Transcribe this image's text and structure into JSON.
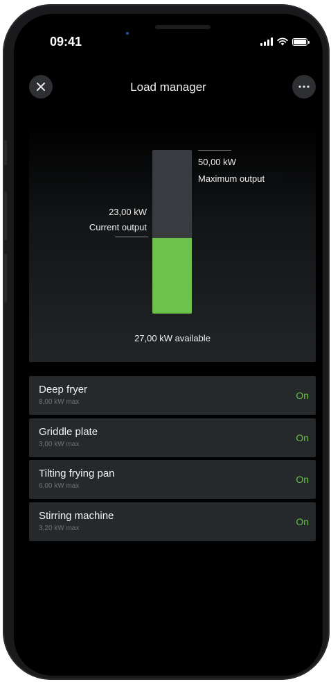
{
  "status_bar": {
    "time": "09:41"
  },
  "header": {
    "title": "Load manager"
  },
  "gauge": {
    "max_value": "50,00 kW",
    "max_label": "Maximum output",
    "current_value": "23,00 kW",
    "current_label": "Current output",
    "available_text": "27,00 kW available",
    "available_fraction": 0.46
  },
  "devices": [
    {
      "name": "Deep fryer",
      "max": "8,00 kW max",
      "state": "On"
    },
    {
      "name": "Griddle plate",
      "max": "3,00 kW max",
      "state": "On"
    },
    {
      "name": "Tilting frying pan",
      "max": "6,00 kW max",
      "state": "On"
    },
    {
      "name": "Stirring machine",
      "max": "3,20 kW max",
      "state": "On"
    }
  ],
  "colors": {
    "accent_green": "#6cc24a",
    "card_bg": "#26292c",
    "background": "#000000"
  },
  "icons": {
    "close": "close-icon",
    "more": "more-icon"
  }
}
